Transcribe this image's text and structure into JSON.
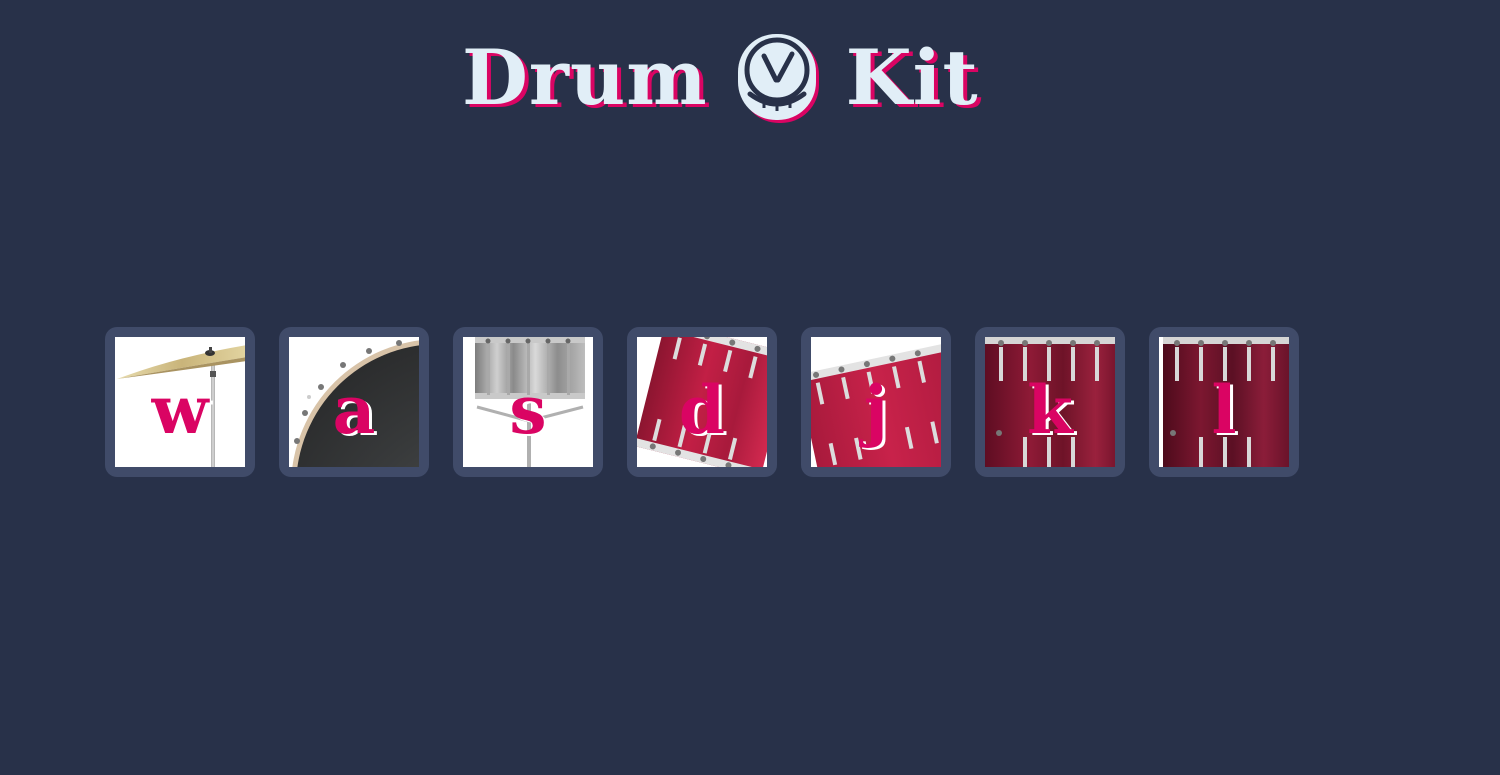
{
  "header": {
    "title_left": "Drum",
    "title_right": "Kit",
    "logo_icon": "drum-face-icon",
    "text_color": "#e1eef7",
    "accent_color": "#da0463"
  },
  "keys": [
    {
      "letter": "w",
      "instrument_icon": "cymbal-icon"
    },
    {
      "letter": "a",
      "instrument_icon": "bass-drum-icon"
    },
    {
      "letter": "s",
      "instrument_icon": "snare-drum-icon"
    },
    {
      "letter": "d",
      "instrument_icon": "tom-drum-icon"
    },
    {
      "letter": "j",
      "instrument_icon": "tom-drum-icon"
    },
    {
      "letter": "k",
      "instrument_icon": "floor-tom-icon"
    },
    {
      "letter": "l",
      "instrument_icon": "floor-tom-icon"
    }
  ],
  "colors": {
    "background": "#283149",
    "key_frame": "#404b69",
    "letter": "#da0463"
  }
}
